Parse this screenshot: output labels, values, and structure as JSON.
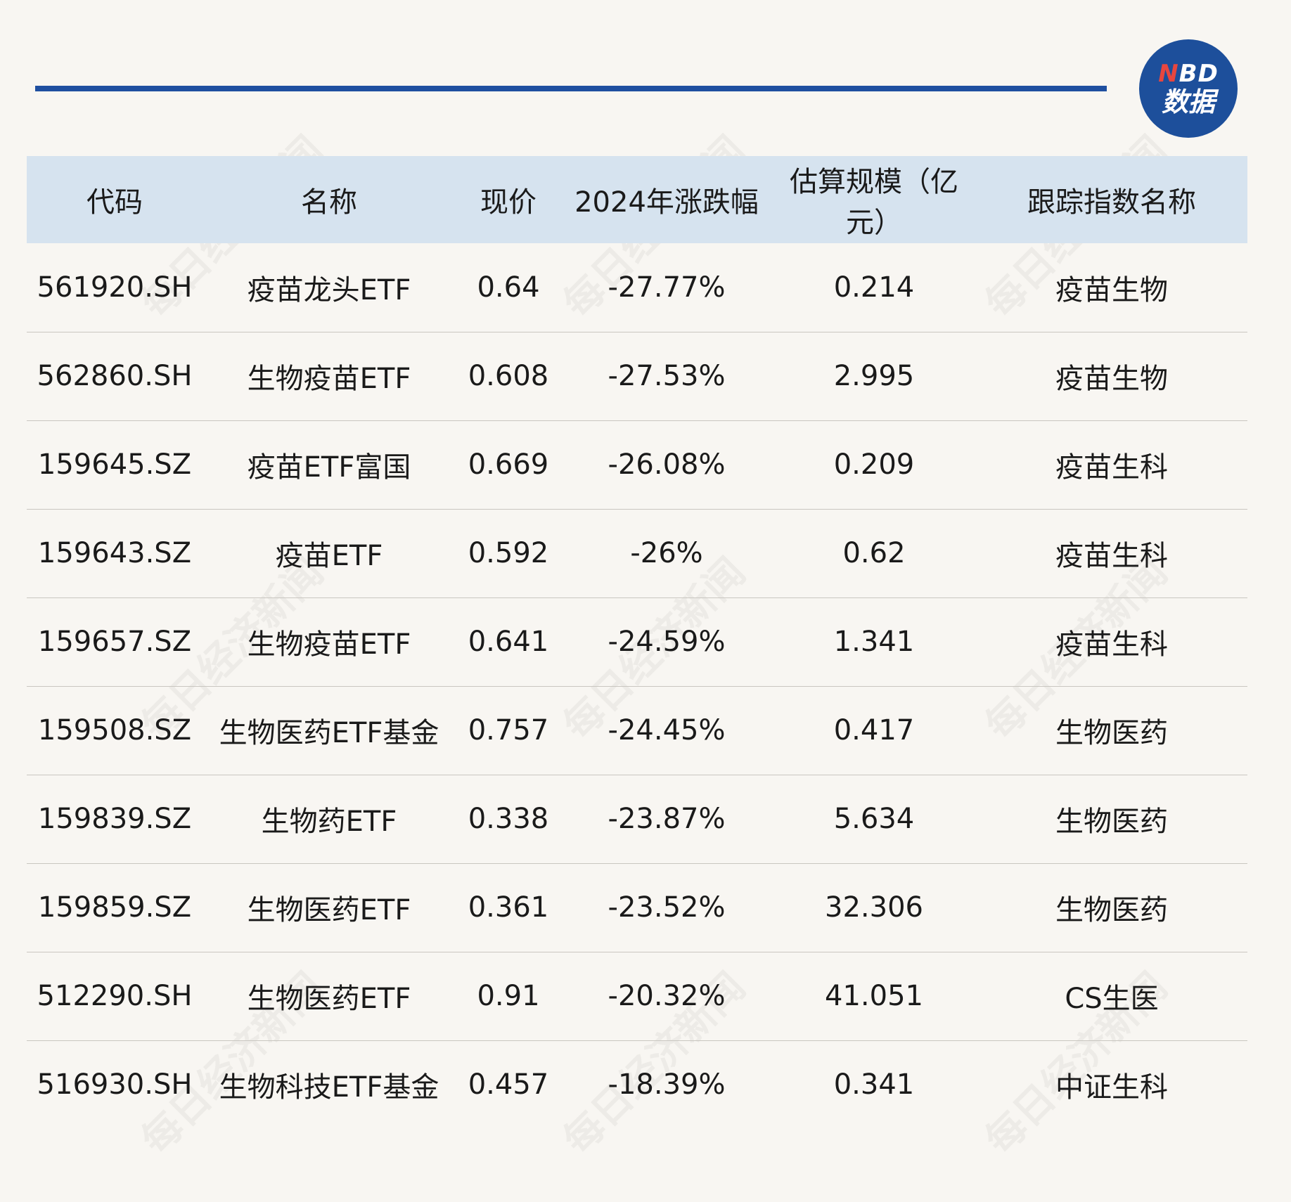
{
  "logo": {
    "line1_accent": "N",
    "line1_rest": "BD",
    "line2": "数据"
  },
  "watermark_text": "每日经济新闻",
  "table": {
    "headers": [
      "代码",
      "名称",
      "现价",
      "2024年涨跌幅",
      "估算规模（亿元）",
      "跟踪指数名称"
    ],
    "rows": [
      [
        "561920.SH",
        "疫苗龙头ETF",
        "0.64",
        "-27.77%",
        "0.214",
        "疫苗生物"
      ],
      [
        "562860.SH",
        "生物疫苗ETF",
        "0.608",
        "-27.53%",
        "2.995",
        "疫苗生物"
      ],
      [
        "159645.SZ",
        "疫苗ETF富国",
        "0.669",
        "-26.08%",
        "0.209",
        "疫苗生科"
      ],
      [
        "159643.SZ",
        "疫苗ETF",
        "0.592",
        "-26%",
        "0.62",
        "疫苗生科"
      ],
      [
        "159657.SZ",
        "生物疫苗ETF",
        "0.641",
        "-24.59%",
        "1.341",
        "疫苗生科"
      ],
      [
        "159508.SZ",
        "生物医药ETF基金",
        "0.757",
        "-24.45%",
        "0.417",
        "生物医药"
      ],
      [
        "159839.SZ",
        "生物药ETF",
        "0.338",
        "-23.87%",
        "5.634",
        "生物医药"
      ],
      [
        "159859.SZ",
        "生物医药ETF",
        "0.361",
        "-23.52%",
        "32.306",
        "生物医药"
      ],
      [
        "512290.SH",
        "生物医药ETF",
        "0.91",
        "-20.32%",
        "41.051",
        "CS生医"
      ],
      [
        "516930.SH",
        "生物科技ETF基金",
        "0.457",
        "-18.39%",
        "0.341",
        "中证生科"
      ]
    ]
  },
  "colors": {
    "background": "#f8f6f2",
    "header_band": "#d6e3ef",
    "rule": "#1f4fa0",
    "logo": "#1d4f9b",
    "logo_accent": "#e8463f"
  }
}
